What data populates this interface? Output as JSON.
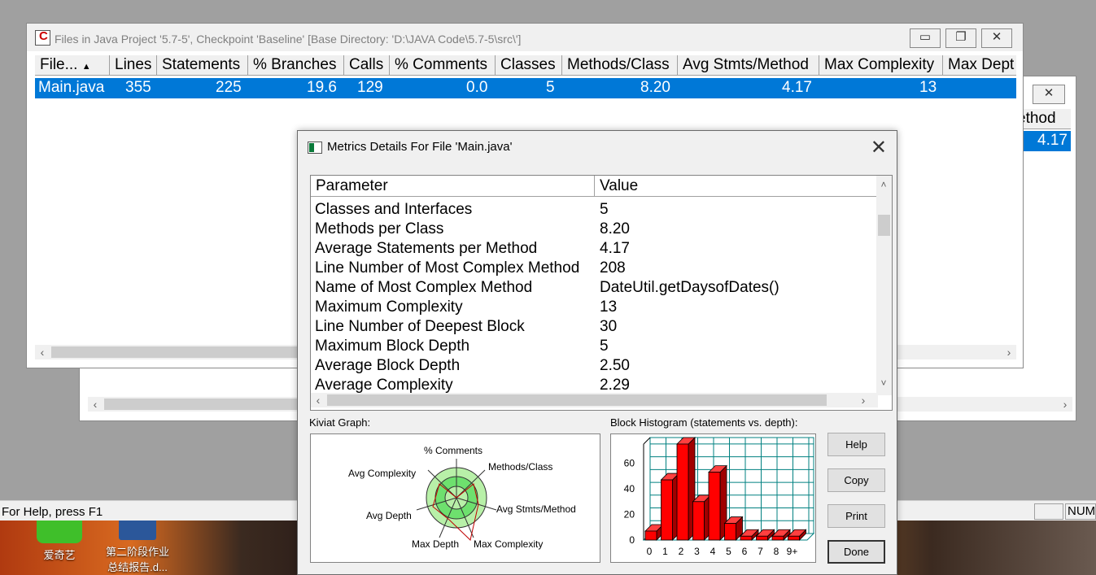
{
  "main_window": {
    "title": "Files in Java Project '5.7-5', Checkpoint 'Baseline'  [Base Directory: 'D:\\JAVA Code\\5.7-5\\src\\']",
    "columns": [
      "File...",
      "Lines",
      "Statements",
      "% Branches",
      "Calls",
      "% Comments",
      "Classes",
      "Methods/Class",
      "Avg Stmts/Method",
      "Max Complexity",
      "Max Dept"
    ],
    "row": [
      "Main.java",
      "355",
      "225",
      "19.6",
      "129",
      "0.0",
      "5",
      "8.20",
      "4.17",
      "13",
      ""
    ]
  },
  "back_window": {
    "header_partial": "ethod",
    "value_partial": "4.17"
  },
  "dialog": {
    "title": "Metrics Details For File 'Main.java'",
    "col_parameter": "Parameter",
    "col_value": "Value",
    "rows": [
      {
        "param": "Classes and Interfaces",
        "value": "5"
      },
      {
        "param": "Methods per Class",
        "value": "8.20"
      },
      {
        "param": "Average Statements per Method",
        "value": "4.17"
      },
      {
        "param": "Line Number of Most Complex Method",
        "value": "208"
      },
      {
        "param": "Name of Most Complex Method",
        "value": "DateUtil.getDaysofDates()"
      },
      {
        "param": "Maximum Complexity",
        "value": "13"
      },
      {
        "param": "Line Number of Deepest Block",
        "value": "30"
      },
      {
        "param": "Maximum Block Depth",
        "value": "5"
      },
      {
        "param": "Average Block Depth",
        "value": "2.50"
      },
      {
        "param": "Average Complexity",
        "value": "2.29"
      }
    ],
    "kiviat_label": "Kiviat Graph:",
    "kiviat_axes": [
      "% Comments",
      "Methods/Class",
      "Avg Stmts/Method",
      "Max Complexity",
      "Max Depth",
      "Avg Depth",
      "Avg Complexity"
    ],
    "histogram_label": "Block Histogram (statements vs. depth):",
    "buttons": {
      "help": "Help",
      "copy": "Copy",
      "print": "Print",
      "done": "Done"
    }
  },
  "chart_data": {
    "type": "bar",
    "title": "Block Histogram (statements vs. depth):",
    "categories": [
      "0",
      "1",
      "2",
      "3",
      "4",
      "5",
      "6",
      "7",
      "8",
      "9+"
    ],
    "values": [
      7,
      47,
      75,
      30,
      53,
      13,
      3,
      3,
      3,
      3
    ],
    "ylim": [
      0,
      75
    ],
    "yticks": [
      "0",
      "20",
      "40",
      "60"
    ],
    "color": "#ff0000"
  },
  "statusbar": {
    "help_text": "For Help, press F1",
    "num": "NUM"
  },
  "desktop": {
    "icon1": "爱奇艺",
    "icon2_line1": "第二阶段作业",
    "icon2_line2": "总结报告.d..."
  }
}
